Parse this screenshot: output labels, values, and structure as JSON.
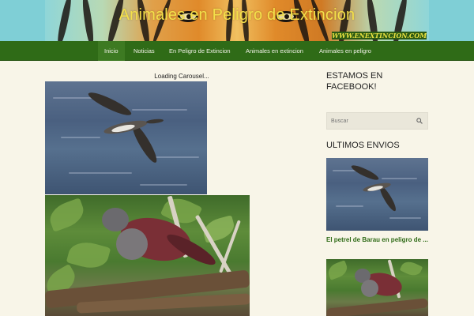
{
  "header": {
    "site_title": "Animales en Peligro de Extincion",
    "domain_watermark": "WWW.ENEXTINCION.COM"
  },
  "nav": {
    "items": [
      {
        "label": "Inicio",
        "active": true
      },
      {
        "label": "Noticias",
        "active": false
      },
      {
        "label": "En Peligro de Extincion",
        "active": false
      },
      {
        "label": "Animales en extincion",
        "active": false
      },
      {
        "label": "Animales en peligro",
        "active": false
      }
    ]
  },
  "main": {
    "carousel_status": "Loading Carousel..."
  },
  "sidebar": {
    "facebook_heading": "ESTAMOS EN FACEBOOK!",
    "search": {
      "placeholder": "Buscar",
      "value": ""
    },
    "recent_heading": "ULTIMOS ENVIOS",
    "recent_posts": [
      {
        "title": "El petrel de Barau en peligro de ..."
      }
    ]
  },
  "colors": {
    "nav_bg": "#2f6b17",
    "nav_active": "#3d7a22",
    "page_bg": "#f8f5e8",
    "link_green": "#2f6b17",
    "title_yellow": "#f4e04a"
  },
  "icons": {
    "search": "search-icon"
  }
}
